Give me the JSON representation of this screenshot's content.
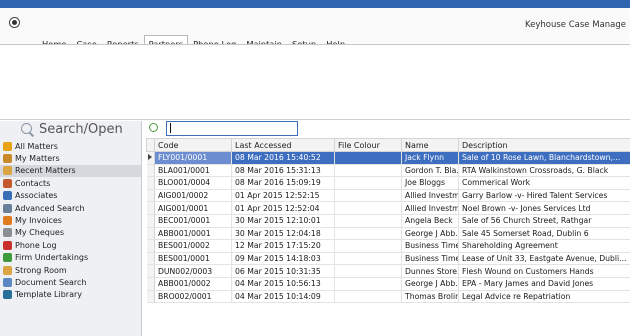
{
  "app": {
    "title": "Keyhouse Case Manage"
  },
  "menu": [
    {
      "label": "Home",
      "active": false
    },
    {
      "label": "Case",
      "active": false
    },
    {
      "label": "Reports",
      "active": false
    },
    {
      "label": "Partners",
      "active": true
    },
    {
      "label": "Phone Log",
      "active": false
    },
    {
      "label": "Maintain",
      "active": false
    },
    {
      "label": "Setup",
      "active": false
    },
    {
      "label": "Help",
      "active": false
    }
  ],
  "sidebar": {
    "header": "Search/Open",
    "items": [
      {
        "label": "All Matters",
        "icon": "all-matters-icon",
        "color": "#e8a317",
        "selected": false
      },
      {
        "label": "My Matters",
        "icon": "my-matters-icon",
        "color": "#c98a2a",
        "selected": false
      },
      {
        "label": "Recent Matters",
        "icon": "recent-matters-icon",
        "color": "#d9a441",
        "selected": true
      },
      {
        "label": "Contacts",
        "icon": "contacts-icon",
        "color": "#c45a2c",
        "selected": false
      },
      {
        "label": "Associates",
        "icon": "associates-icon",
        "color": "#3a6fb8",
        "selected": false
      },
      {
        "label": "Advanced Search",
        "icon": "advanced-search-icon",
        "color": "#6a7f99",
        "selected": false
      },
      {
        "label": "My Invoices",
        "icon": "invoices-icon",
        "color": "#e07a1f",
        "selected": false
      },
      {
        "label": "My Cheques",
        "icon": "cheques-icon",
        "color": "#8a8f96",
        "selected": false
      },
      {
        "label": "Phone Log",
        "icon": "phone-log-icon",
        "color": "#c9302c",
        "selected": false
      },
      {
        "label": "Firm Undertakings",
        "icon": "undertakings-icon",
        "color": "#3e9a3a",
        "selected": false
      },
      {
        "label": "Strong Room",
        "icon": "strong-room-icon",
        "color": "#d9a441",
        "selected": false
      },
      {
        "label": "Document Search",
        "icon": "document-search-icon",
        "color": "#5b88c4",
        "selected": false
      },
      {
        "label": "Template Library",
        "icon": "template-library-icon",
        "color": "#2a6e9a",
        "selected": false
      }
    ]
  },
  "filter": {
    "value": ""
  },
  "table": {
    "columns": [
      "Code",
      "Last Accessed",
      "File Colour",
      "Name",
      "Description"
    ],
    "rows": [
      [
        "FLY001/0001",
        "08 Mar 2016 15:40:52",
        "",
        "Jack Flynn",
        "Sale of 10 Rose Lawn, Blanchardstown,..."
      ],
      [
        "BLA001/0001",
        "08 Mar 2016 15:31:13",
        "",
        "Gordon T. Bla...",
        "RTA Walkinstown Crossroads, G. Black"
      ],
      [
        "BLO001/0004",
        "08 Mar 2016 15:09:19",
        "",
        "Joe Bloggs",
        "Commerical Work"
      ],
      [
        "AIG001/0002",
        "01 Apr 2015 12:52:15",
        "",
        "Allied Investm...",
        "Garry Barlow -v- Hired Talent Services"
      ],
      [
        "AIG001/0001",
        "01 Apr 2015 12:52:04",
        "",
        "Allied Investm...",
        "Noel Brown -v- Jones Services Ltd"
      ],
      [
        "BEC001/0001",
        "30 Mar 2015 12:10:01",
        "",
        "Angela Beck",
        "Sale of 56 Church Street, Rathgar"
      ],
      [
        "ABB001/0001",
        "30 Mar 2015 12:04:18",
        "",
        "George J Abb...",
        "Sale 45 Somerset Road, Dublin 6"
      ],
      [
        "BES001/0002",
        "12 Mar 2015 17:15:20",
        "",
        "Business Time...",
        "Shareholding Agreement"
      ],
      [
        "BES001/0001",
        "09 Mar 2015 14:18:03",
        "",
        "Business Time...",
        "Lease of Unit 33, Eastgate Avenue, Dubli..."
      ],
      [
        "DUN002/0003",
        "06 Mar 2015 10:31:35",
        "",
        "Dunnes Store...",
        "Flesh Wound on Customers Hands"
      ],
      [
        "ABB001/0002",
        "04 Mar 2015 10:56:13",
        "",
        "George J Abb...",
        "EPA - Mary James and David Jones"
      ],
      [
        "BRO002/0001",
        "04 Mar 2015 10:14:09",
        "",
        "Thomas Brolin",
        "Legal Advice re Repatriation"
      ]
    ],
    "selected_row": 0
  }
}
